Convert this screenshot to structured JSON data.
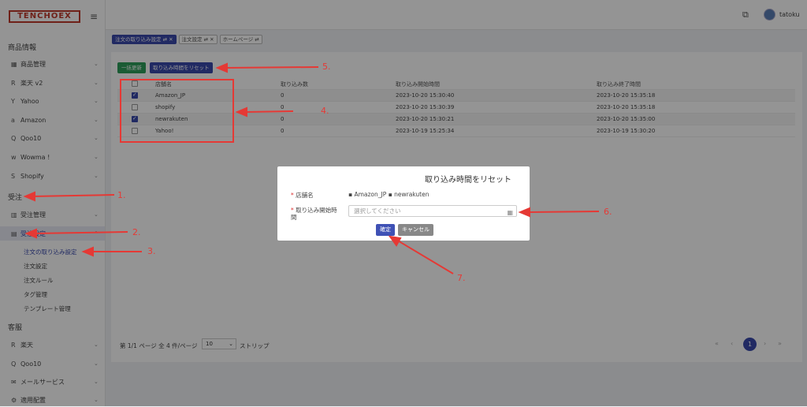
{
  "logo": "TENCHOEX",
  "sidebar": {
    "section1": "商品情報",
    "items1": [
      {
        "label": "商品管理",
        "icon": "▦"
      },
      {
        "label": "楽天 v2",
        "icon": "R"
      },
      {
        "label": "Yahoo",
        "icon": "Y"
      },
      {
        "label": "Amazon",
        "icon": "a"
      },
      {
        "label": "Qoo10",
        "icon": "Q"
      },
      {
        "label": "Wowma !",
        "icon": "w"
      },
      {
        "label": "Shopify",
        "icon": "S"
      }
    ],
    "section2": "受注",
    "items2": [
      {
        "label": "受注管理",
        "icon": "▥"
      },
      {
        "label": "受注設定",
        "icon": "▤"
      }
    ],
    "subitems": [
      "注文の取り込み設定",
      "注文設定",
      "注文ルール",
      "タグ管理",
      "テンプレート管理"
    ],
    "section3": "客服",
    "items3": [
      {
        "label": "楽天",
        "icon": "R"
      },
      {
        "label": "Qoo10",
        "icon": "Q"
      },
      {
        "label": "メールサービス",
        "icon": "✉"
      },
      {
        "label": "適用配置",
        "icon": "⚙"
      }
    ]
  },
  "header": {
    "username": "tatoku"
  },
  "tags": [
    "注文の取り込み設定 ⇄ ✕",
    "注文設定 ⇄ ✕",
    "ホームページ ⇄"
  ],
  "toolbar": {
    "bulk_update": "一括更新",
    "reset_time": "取り込み時間をリセット"
  },
  "table": {
    "headers": [
      "店舗名",
      "取り込み数",
      "取り込み開始時間",
      "取り込み終了時間"
    ],
    "rows": [
      {
        "checked": true,
        "store": "Amazon_JP",
        "count": "0",
        "start": "2023-10-20 15:30:40",
        "end": "2023-10-20 15:35:18"
      },
      {
        "checked": false,
        "store": "shopify",
        "count": "0",
        "start": "2023-10-20 15:30:39",
        "end": "2023-10-20 15:35:18"
      },
      {
        "checked": true,
        "store": "newrakuten",
        "count": "0",
        "start": "2023-10-20 15:30:21",
        "end": "2023-10-20 15:35:00"
      },
      {
        "checked": false,
        "store": "Yahoo!",
        "count": "0",
        "start": "2023-10-19 15:25:34",
        "end": "2023-10-19 15:30:20"
      }
    ]
  },
  "pager": {
    "summary": "第 1/1 ページ 全 4 件/ページ",
    "per_page": "10",
    "strip": "ストリップ",
    "current": "1"
  },
  "dialog": {
    "title": "取り込み時間をリセット",
    "store_label": "店舗名",
    "stores": "▪  Amazon_JP  ▪  newrakuten",
    "time_label": "取り込み開始時間",
    "placeholder": "選択してください",
    "ok": "確定",
    "cancel": "キャンセル"
  },
  "annotations": [
    "1.",
    "2.",
    "3.",
    "4.",
    "5.",
    "6.",
    "7."
  ],
  "colors": {
    "accent": "#3949ab",
    "annotation": "#e53935",
    "green": "#2e9e5a"
  }
}
